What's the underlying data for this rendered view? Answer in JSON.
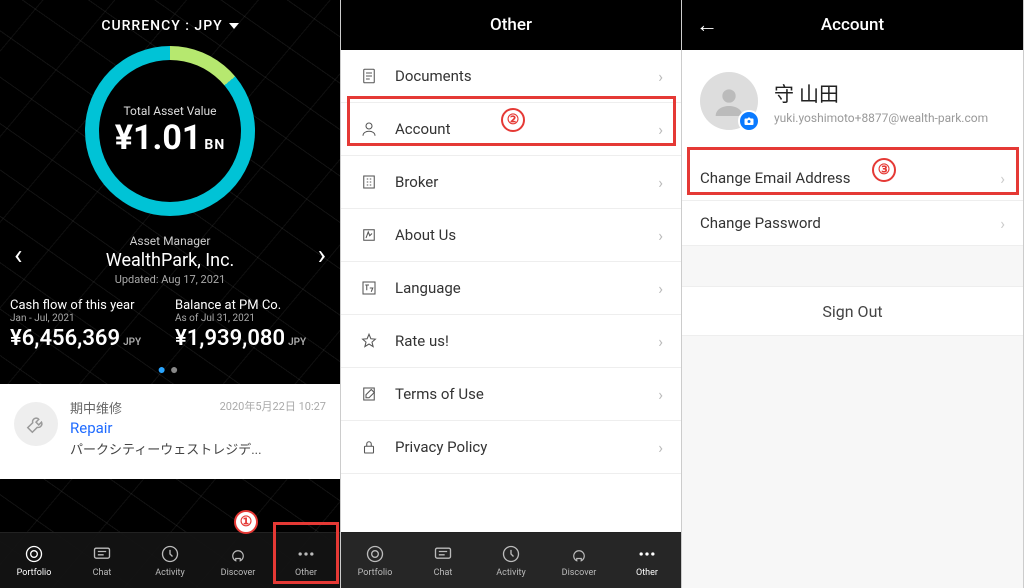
{
  "phone1": {
    "currency_label": "CURRENCY : JPY",
    "donut": {
      "label": "Total Asset Value",
      "value": "¥1.01",
      "suffix": "BN"
    },
    "manager": {
      "label": "Asset Manager",
      "name": "WealthPark, Inc.",
      "updated": "Updated: Aug 17, 2021"
    },
    "stats": {
      "cashflow": {
        "label": "Cash flow of this year",
        "period": "Jan - Jul, 2021",
        "value": "¥6,456,369",
        "cur": "JPY"
      },
      "balance": {
        "label": "Balance at PM Co.",
        "period": "As of Jul 31, 2021",
        "value": "¥1,939,080",
        "cur": "JPY"
      }
    },
    "card": {
      "tag": "期中维修",
      "date": "2020年5月22日 10:27",
      "title": "Repair",
      "subtitle": "パークシティーウェストレジデ..."
    },
    "tabs": [
      "Portfolio",
      "Chat",
      "Activity",
      "Discover",
      "Other"
    ]
  },
  "phone2": {
    "title": "Other",
    "items": [
      {
        "label": "Documents"
      },
      {
        "label": "Account"
      },
      {
        "label": "Broker"
      },
      {
        "label": "About Us"
      },
      {
        "label": "Language"
      },
      {
        "label": "Rate us!"
      },
      {
        "label": "Terms of Use"
      },
      {
        "label": "Privacy Policy"
      }
    ]
  },
  "phone3": {
    "title": "Account",
    "profile": {
      "name": "守 山田",
      "email": "yuki.yoshimoto+8877@wealth-park.com"
    },
    "items": [
      {
        "label": "Change Email Address"
      },
      {
        "label": "Change Password"
      }
    ],
    "signout": "Sign Out"
  },
  "callouts": {
    "one": "①",
    "two": "②",
    "three": "③"
  }
}
